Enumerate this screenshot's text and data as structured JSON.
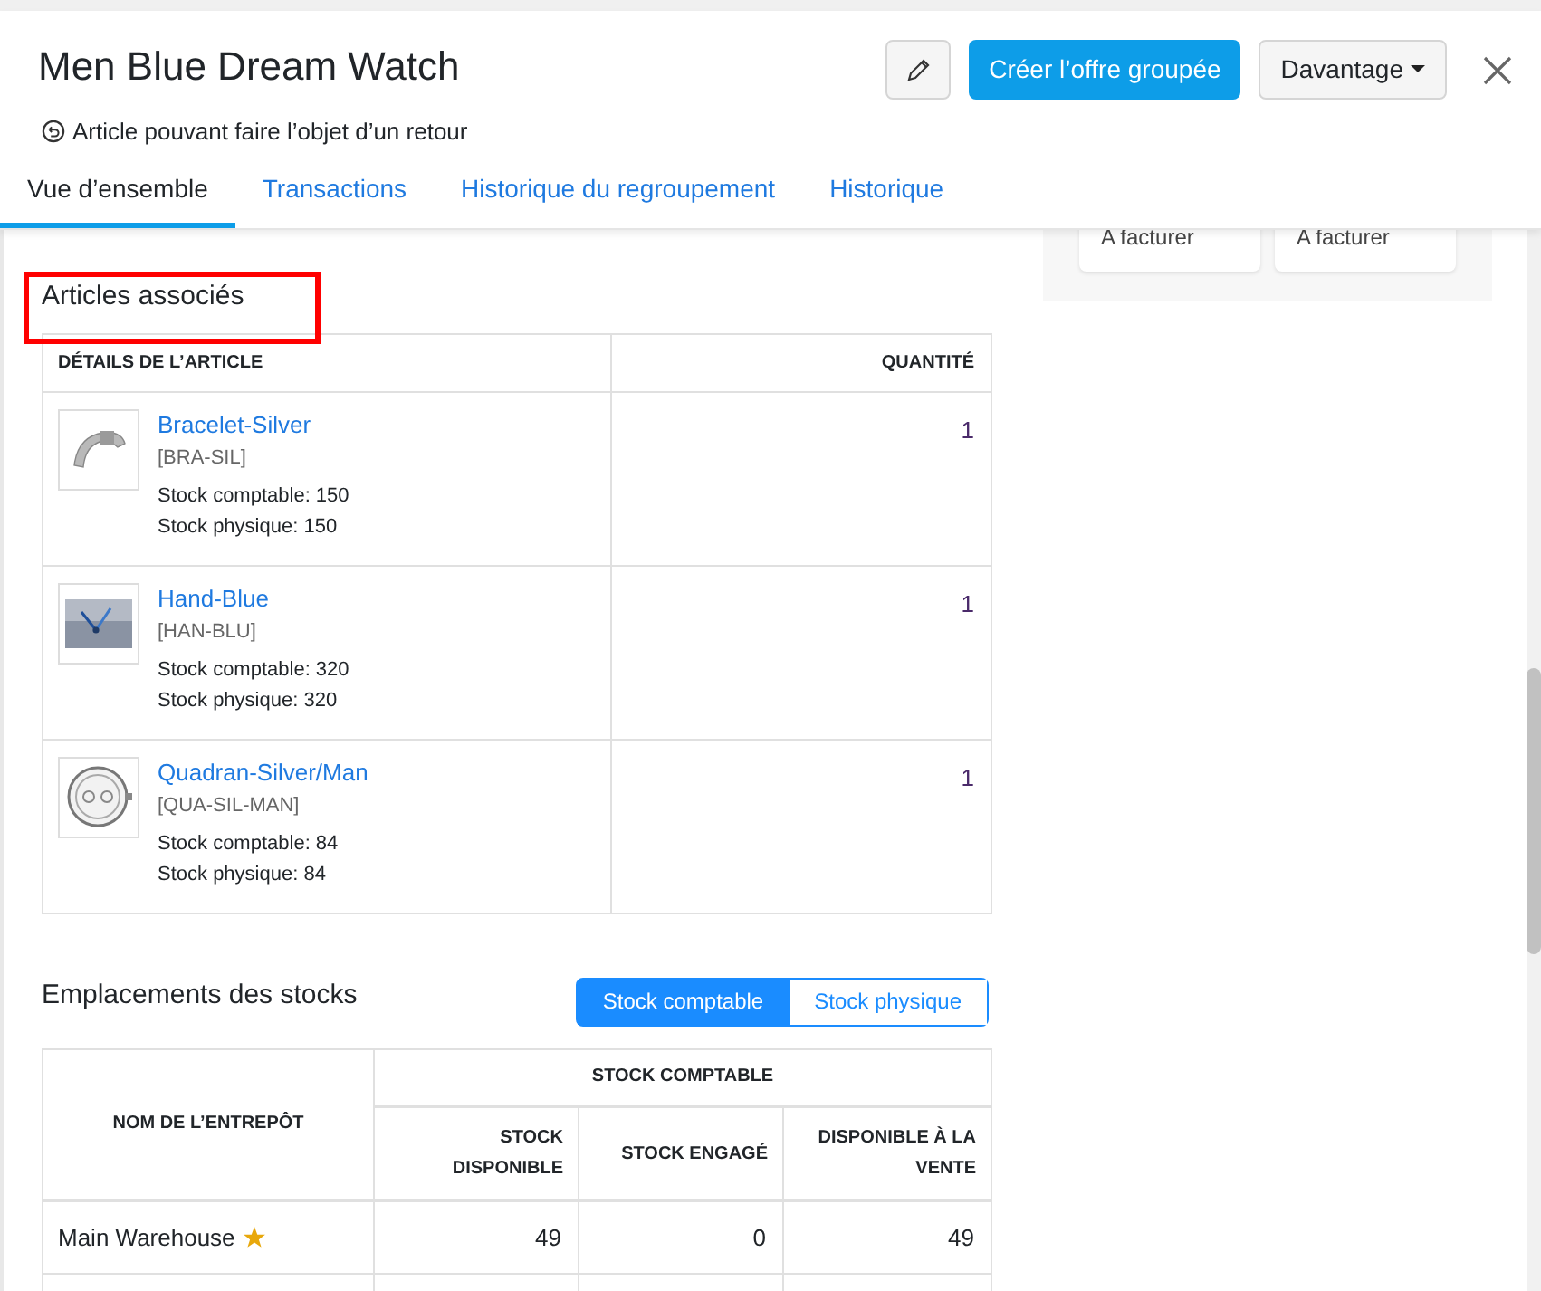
{
  "header": {
    "title": "Men Blue Dream Watch",
    "subtitle": "Article pouvant faire l’objet d’un retour",
    "primary_button": "Créer l’offre groupée",
    "more_button": "Davantage"
  },
  "tabs": [
    {
      "label": "Vue d’ensemble",
      "selected": true
    },
    {
      "label": "Transactions",
      "selected": false
    },
    {
      "label": "Historique du regroupement",
      "selected": false
    },
    {
      "label": "Historique",
      "selected": false
    }
  ],
  "side_cards": [
    "A facturer",
    "A facturer"
  ],
  "associated_items": {
    "title": "Articles associés",
    "highlighted": true,
    "columns": [
      "DÉTAILS DE L’ARTICLE",
      "QUANTITÉ"
    ],
    "rows": [
      {
        "name": "Bracelet-Silver",
        "sku": "[BRA-SIL]",
        "accounting_stock": "Stock comptable: 150",
        "physical_stock": "Stock physique: 150",
        "quantity": "1"
      },
      {
        "name": "Hand-Blue",
        "sku": "[HAN-BLU]",
        "accounting_stock": "Stock comptable: 320",
        "physical_stock": "Stock physique: 320",
        "quantity": "1"
      },
      {
        "name": "Quadran-Silver/Man",
        "sku": "[QUA-SIL-MAN]",
        "accounting_stock": "Stock comptable: 84",
        "physical_stock": "Stock physique: 84",
        "quantity": "1"
      }
    ]
  },
  "stock_locations": {
    "title": "Emplacements des stocks",
    "toggle": [
      {
        "label": "Stock comptable",
        "selected": true
      },
      {
        "label": "Stock physique",
        "selected": false
      }
    ],
    "columns": {
      "warehouse": "NOM DE L’ENTREPÔT",
      "group": "STOCK COMPTABLE",
      "sub": [
        "STOCK DISPONIBLE",
        "STOCK ENGAGÉ",
        "DISPONIBLE À LA VENTE"
      ]
    },
    "rows": [
      {
        "name": "Main Warehouse",
        "primary": true,
        "values": [
          "49",
          "0",
          "49"
        ]
      }
    ]
  }
}
